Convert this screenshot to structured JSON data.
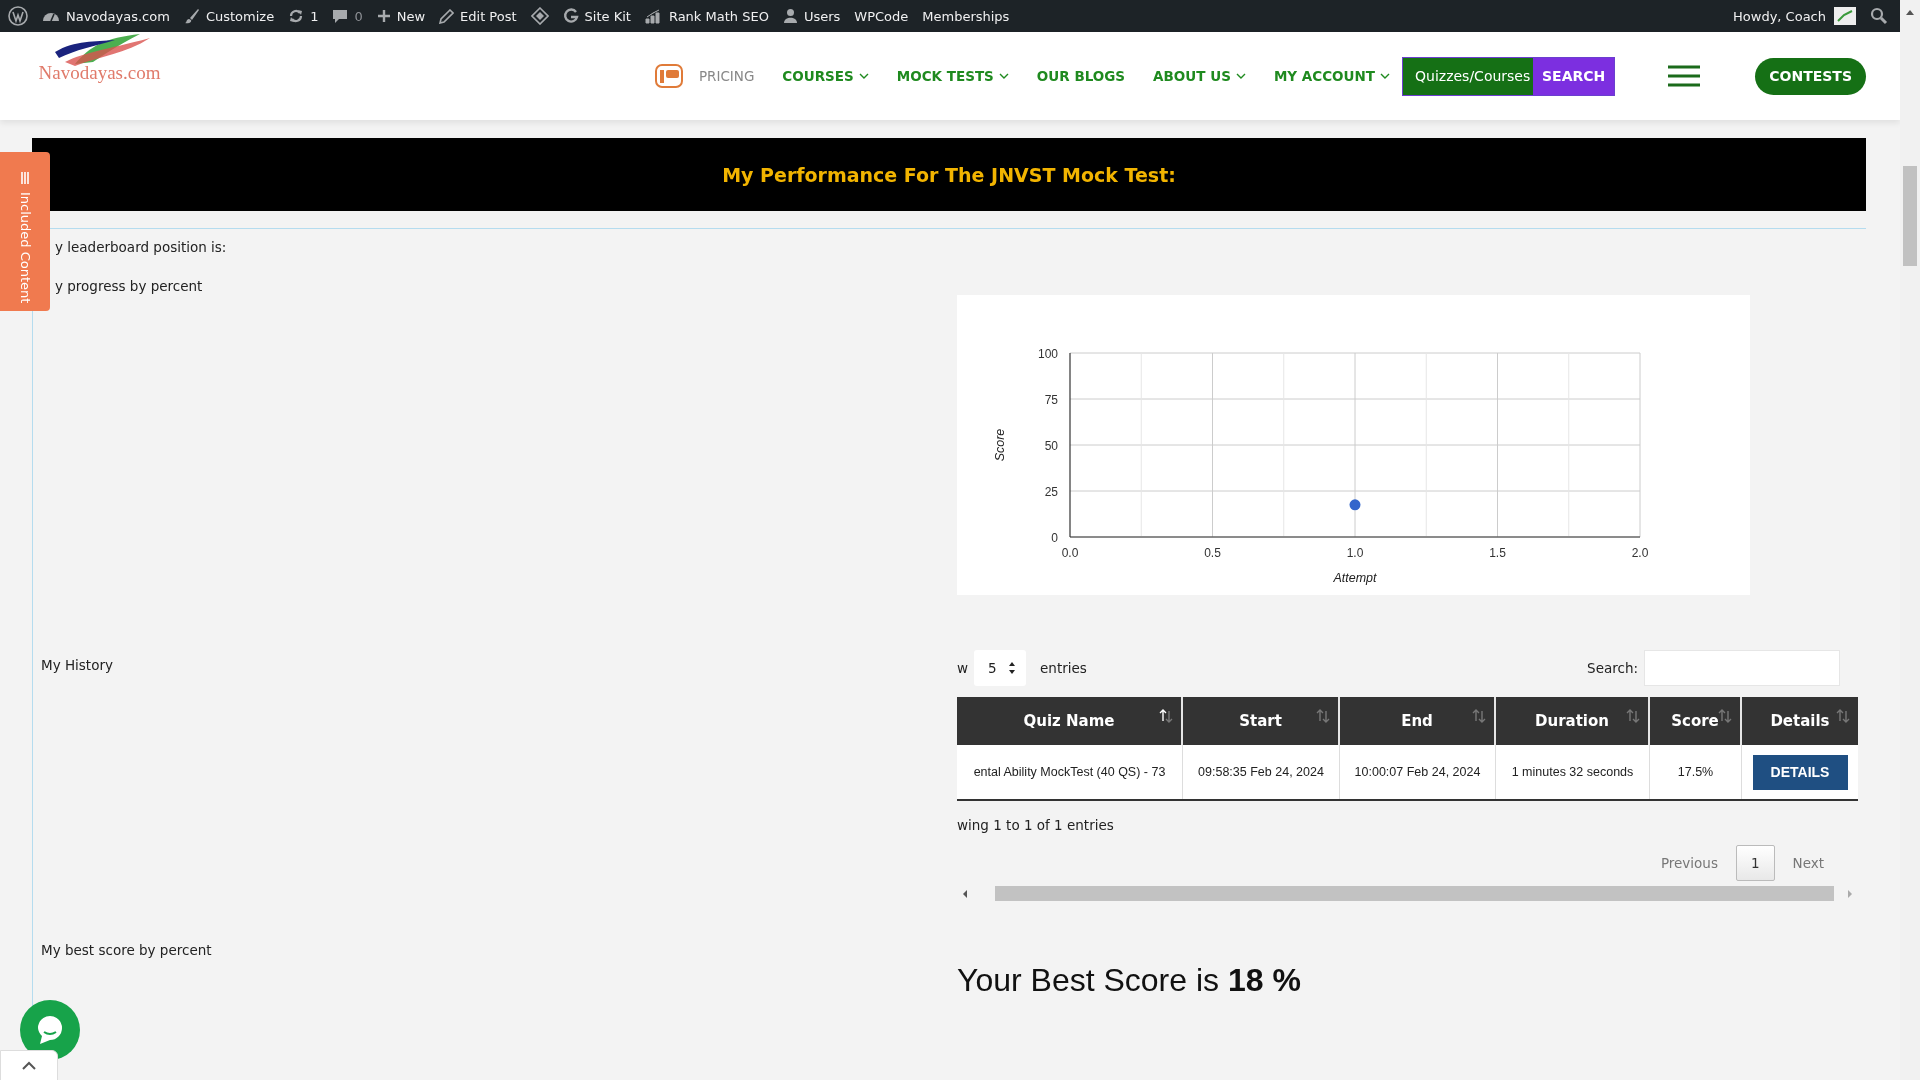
{
  "admin_bar": {
    "items": [
      {
        "kind": "wp-logo"
      },
      {
        "kind": "site",
        "label": "Navodayas.com"
      },
      {
        "kind": "customize",
        "label": "Customize"
      },
      {
        "kind": "updates",
        "label": "1"
      },
      {
        "kind": "comments",
        "label": "0"
      },
      {
        "kind": "new",
        "label": "New"
      },
      {
        "kind": "edit",
        "label": "Edit Post"
      },
      {
        "kind": "diamond"
      },
      {
        "kind": "sitekit",
        "label": "Site Kit"
      },
      {
        "kind": "rankmath",
        "label": "Rank Math SEO"
      },
      {
        "kind": "users",
        "label": "Users"
      },
      {
        "kind": "text",
        "label": "WPCode"
      },
      {
        "kind": "text",
        "label": "Memberships"
      }
    ],
    "greeting": "Howdy, Coach"
  },
  "header": {
    "logo_text": "Navodayas.com",
    "nav": [
      {
        "kind": "icon-link",
        "label": "PRICING",
        "dropdown": false
      },
      {
        "kind": "link",
        "label": "COURSES",
        "dropdown": true
      },
      {
        "kind": "link",
        "label": "MOCK TESTS",
        "dropdown": true
      },
      {
        "kind": "link",
        "label": "OUR BLOGS",
        "dropdown": false
      },
      {
        "kind": "link",
        "label": "ABOUT US",
        "dropdown": true
      },
      {
        "kind": "link",
        "label": "MY ACCOUNT",
        "dropdown": true
      }
    ],
    "search": {
      "placeholder": "Quizzes/Courses",
      "button": "SEARCH"
    },
    "cta": "CONTESTS"
  },
  "side_tab": "Included Content",
  "banner": "My Performance For The JNVST Mock Test:",
  "leaderboard_label": "y leaderboard position is:",
  "progress_label": "y progress by percent",
  "chart_data": {
    "type": "scatter",
    "xlabel": "Attempt",
    "ylabel": "Score",
    "x": [
      1.0
    ],
    "grid": true,
    "series": [
      {
        "color": "#3366cc",
        "values": [
          17.5
        ]
      }
    ],
    "xlim": [
      0,
      2
    ],
    "ylim": [
      0,
      100
    ],
    "xticks": [
      {
        "value": 0,
        "label": "0.0"
      },
      {
        "value": 0.5,
        "label": "0.5"
      },
      {
        "value": 1,
        "label": "1.0"
      },
      {
        "value": 1.5,
        "label": "1.5"
      },
      {
        "value": 2,
        "label": "2.0"
      }
    ],
    "yticks": [
      0,
      25,
      50,
      75,
      100
    ]
  },
  "history_label": "My History",
  "history": {
    "show_label": "w",
    "page_size": "5",
    "entries_label": "entries",
    "search_label": "Search:",
    "columns": [
      {
        "label": "Quiz Name",
        "sorted": true
      },
      {
        "label": "Start",
        "sorted": false
      },
      {
        "label": "End",
        "sorted": false
      },
      {
        "label": "Duration",
        "sorted": false
      },
      {
        "label": "Score",
        "sorted": false
      },
      {
        "label": "Details",
        "sorted": false
      }
    ],
    "rows": [
      {
        "quiz_name": "ental Ability MockTest (40 QS) - 73",
        "start": "09:58:35 Feb 24, 2024",
        "end": "10:00:07 Feb 24, 2024",
        "duration": "1 minutes 32 seconds",
        "score": "17.5%",
        "details": "DETAILS"
      }
    ],
    "info": "wing 1 to 1 of 1 entries",
    "pagination": [
      {
        "label": "Previous",
        "kind": "prev",
        "selected": false
      },
      {
        "label": "1",
        "kind": "page",
        "selected": true
      },
      {
        "label": "Next",
        "kind": "next",
        "selected": false
      }
    ]
  },
  "best_label": "My best score by percent",
  "best_score": "Your Best Score is **18 %**"
}
